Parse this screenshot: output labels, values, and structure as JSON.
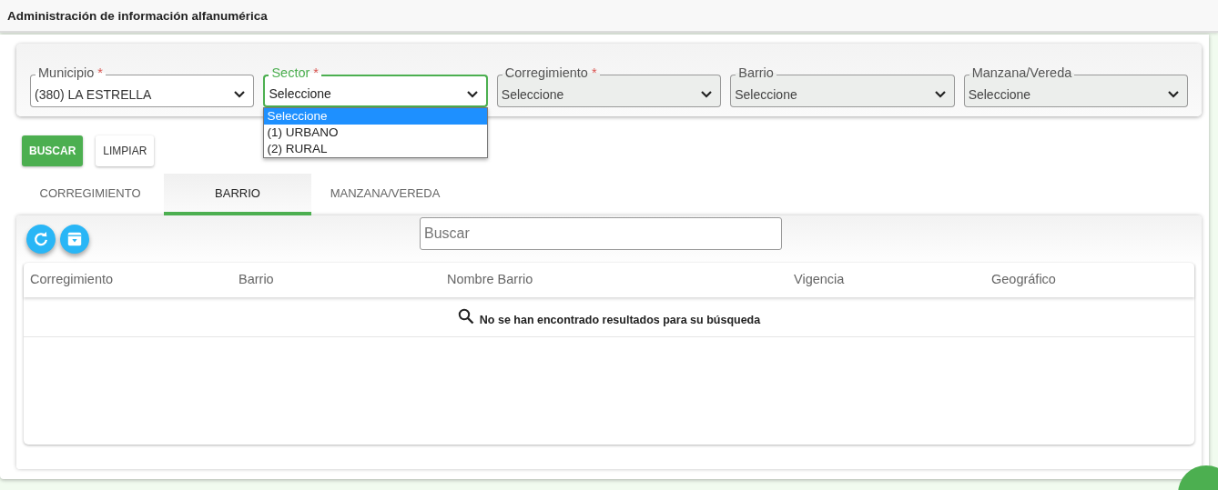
{
  "header": {
    "title": "Administración de información alfanumérica"
  },
  "filters": [
    {
      "label": "Municipio",
      "required_mark": "*",
      "value": "(380) LA ESTRELLA",
      "disabled": false,
      "focused": false
    },
    {
      "label": "Sector",
      "required_mark": "*",
      "value": "Seleccione",
      "disabled": false,
      "focused": true,
      "options": [
        {
          "label": "Seleccione",
          "selected": true
        },
        {
          "label": "(1) URBANO",
          "selected": false
        },
        {
          "label": "(2) RURAL",
          "selected": false
        }
      ]
    },
    {
      "label": "Corregimiento",
      "required_mark": "*",
      "value": "Seleccione",
      "disabled": true,
      "focused": false
    },
    {
      "label": "Barrio",
      "value": "Seleccione",
      "disabled": true,
      "focused": false
    },
    {
      "label": "Manzana/Vereda",
      "value": "Seleccione",
      "disabled": true,
      "focused": false
    }
  ],
  "buttons": [
    {
      "label": "BUSCAR",
      "kind": "primary"
    },
    {
      "label": "LIMPIAR",
      "kind": "secondary"
    }
  ],
  "tabs": [
    {
      "label": "CORREGIMIENTO",
      "selected": false
    },
    {
      "label": "BARRIO",
      "selected": true
    },
    {
      "label": "MANZANA/VEREDA",
      "selected": false
    }
  ],
  "toolbar": {
    "search_placeholder": "Buscar"
  },
  "table": {
    "columns": [
      "Corregimiento",
      "Barrio",
      "Nombre Barrio",
      "Vigencia",
      "Geográfico"
    ],
    "empty_message": "No se han encontrado resultados para su búsqueda"
  }
}
